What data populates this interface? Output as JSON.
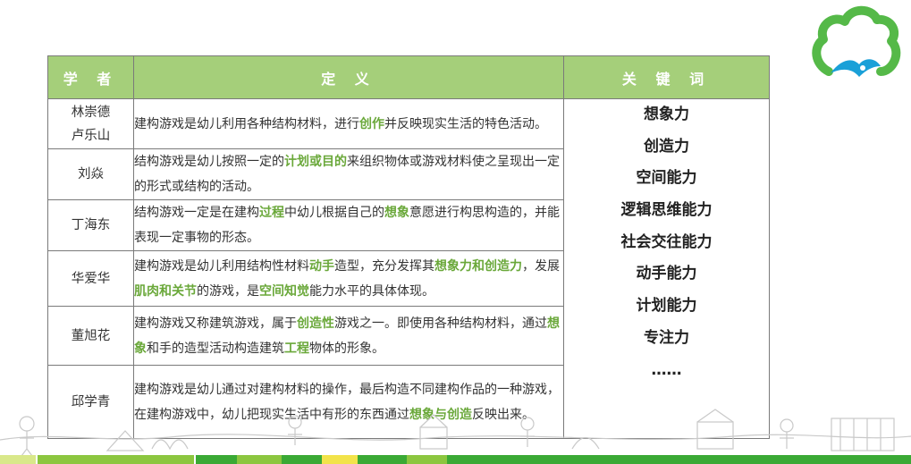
{
  "table": {
    "headers": {
      "scholar": "学 者",
      "definition": "定 义",
      "keywords": "关 键 词"
    },
    "rows": [
      {
        "scholar": "林崇德\n卢乐山",
        "definition": [
          {
            "text": "建构游戏是幼儿利用各种结构材料，进行"
          },
          {
            "text": "创作",
            "hl": true
          },
          {
            "text": "并反映现实生活的特色活动。"
          }
        ]
      },
      {
        "scholar": "刘焱",
        "definition": [
          {
            "text": "结构游戏是幼儿按照一定的"
          },
          {
            "text": "计划或目的",
            "hl": true
          },
          {
            "text": "来组织物体或游戏材料使之呈现出一定的形式或结构的活动。"
          }
        ]
      },
      {
        "scholar": "丁海东",
        "definition": [
          {
            "text": "结构游戏一定是在建构"
          },
          {
            "text": "过程",
            "hl": true
          },
          {
            "text": "中幼儿根据自己的"
          },
          {
            "text": "想象",
            "hl": true
          },
          {
            "text": "意愿进行构思构造的，并能表现一定事物的形态。"
          }
        ]
      },
      {
        "scholar": "华爱华",
        "definition": [
          {
            "text": "建构游戏是幼儿利用结构性材料"
          },
          {
            "text": "动手",
            "hl": true
          },
          {
            "text": "造型，充分发挥其"
          },
          {
            "text": "想象力和创造力",
            "hl": true
          },
          {
            "text": "，发展"
          },
          {
            "text": "肌肉和关节",
            "hl": true
          },
          {
            "text": "的游戏，是"
          },
          {
            "text": "空间知觉",
            "hl": true
          },
          {
            "text": "能力水平的具体体现。"
          }
        ]
      },
      {
        "scholar": "董旭花",
        "definition": [
          {
            "text": "建构游戏又称建筑游戏，属于"
          },
          {
            "text": "创造性",
            "hl": true
          },
          {
            "text": "游戏之一。即使用各种结构材料，通过"
          },
          {
            "text": "想象",
            "hl": true
          },
          {
            "text": "和手的造型活动构造建筑"
          },
          {
            "text": "工程",
            "hl": true
          },
          {
            "text": "物体的形象。"
          }
        ]
      },
      {
        "scholar": "邱学青",
        "definition": [
          {
            "text": "建构游戏是幼儿通过对建构材料的操作，最后构造不同建构作品的一种游戏，在建构游戏中，幼儿把现实生活中有形的东西通过"
          },
          {
            "text": "想象与创造",
            "hl": true
          },
          {
            "text": "反映出来。"
          }
        ]
      }
    ],
    "keywords": [
      "想象力",
      "创造力",
      "空间能力",
      "逻辑思维能力",
      "社会交往能力",
      "动手能力",
      "计划能力",
      "专注力",
      "……"
    ]
  },
  "colors": {
    "header_bg": "#a5cf7a",
    "highlight": "#6aa83a",
    "logo_green": "#55b948",
    "logo_blue": "#1aa0d8"
  },
  "icons": {
    "logo": "tree-cloud-logo",
    "decoration": "children-drawing-doodle"
  }
}
